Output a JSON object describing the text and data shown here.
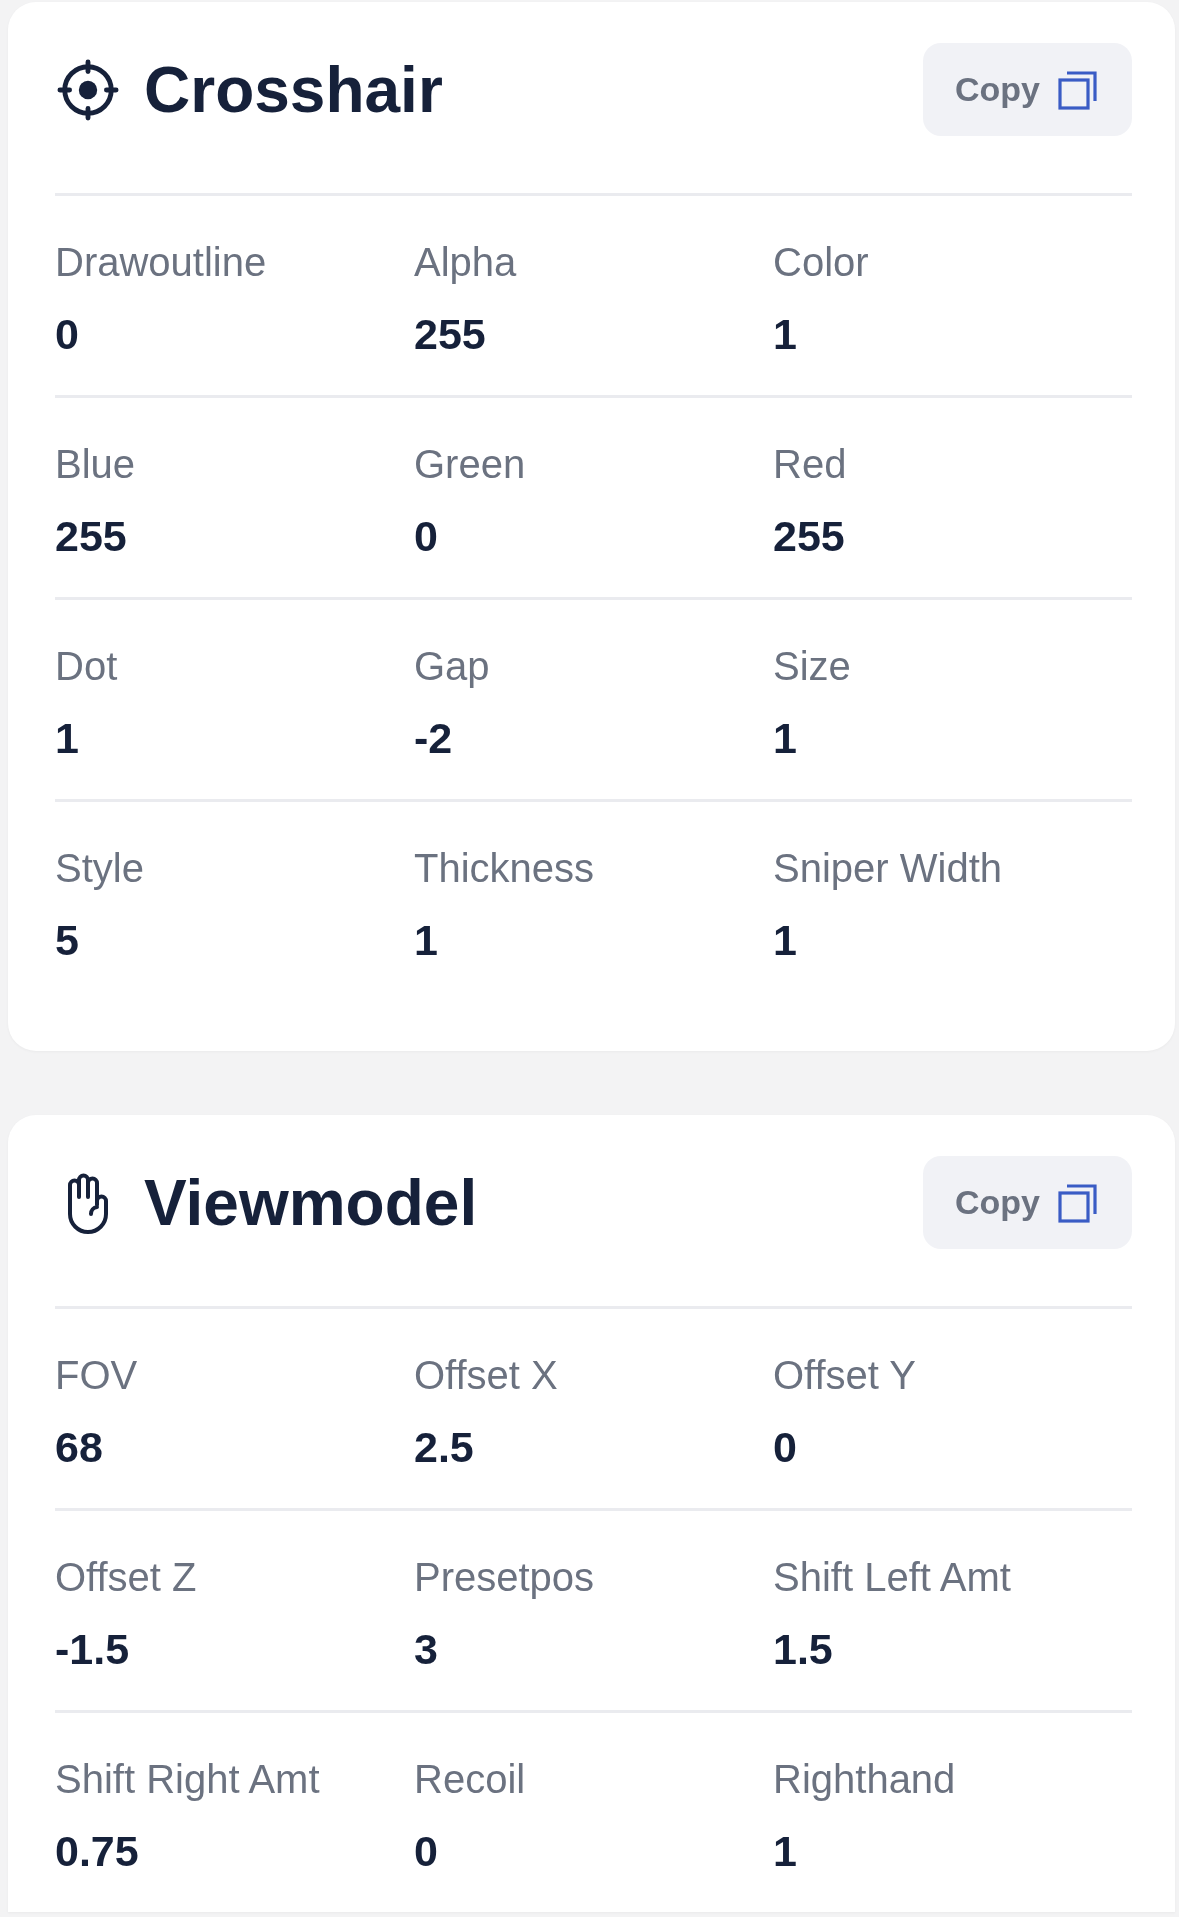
{
  "sections": [
    {
      "kind": "crosshair",
      "title": "Crosshair",
      "copy_button": "Copy",
      "settings": [
        {
          "label": "Drawoutline",
          "value": "0"
        },
        {
          "label": "Alpha",
          "value": "255"
        },
        {
          "label": "Color",
          "value": "1"
        },
        {
          "label": "Blue",
          "value": "255"
        },
        {
          "label": "Green",
          "value": "0"
        },
        {
          "label": "Red",
          "value": "255"
        },
        {
          "label": "Dot",
          "value": "1"
        },
        {
          "label": "Gap",
          "value": "-2"
        },
        {
          "label": "Size",
          "value": "1"
        },
        {
          "label": "Style",
          "value": "5"
        },
        {
          "label": "Thickness",
          "value": "1"
        },
        {
          "label": "Sniper Width",
          "value": "1"
        }
      ]
    },
    {
      "kind": "viewmodel",
      "title": "Viewmodel",
      "copy_button": "Copy",
      "settings": [
        {
          "label": "FOV",
          "value": "68"
        },
        {
          "label": "Offset X",
          "value": "2.5"
        },
        {
          "label": "Offset Y",
          "value": "0"
        },
        {
          "label": "Offset Z",
          "value": "-1.5"
        },
        {
          "label": "Presetpos",
          "value": "3"
        },
        {
          "label": "Shift Left Amt",
          "value": "1.5"
        },
        {
          "label": "Shift Right Amt",
          "value": "0.75"
        },
        {
          "label": "Recoil",
          "value": "0"
        },
        {
          "label": "Righthand",
          "value": "1"
        }
      ]
    }
  ]
}
